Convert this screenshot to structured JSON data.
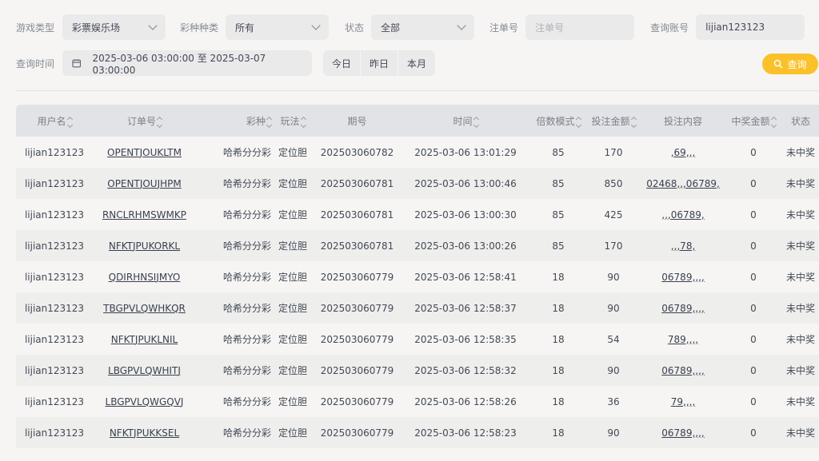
{
  "filters": {
    "game_type_label": "游戏类型",
    "game_type_value": "彩票娱乐场",
    "lottery_label": "彩种种类",
    "lottery_value": "所有",
    "status_label": "状态",
    "status_value": "全部",
    "order_no_label": "注单号",
    "order_no_placeholder": "注单号",
    "account_label": "查询账号",
    "account_value": "lijian123123",
    "time_label": "查询时间",
    "date_range": "2025-03-06 03:00:00 至 2025-03-07 03:00:00",
    "quick_today": "今日",
    "quick_yesterday": "昨日",
    "quick_month": "本月",
    "query_button": "查询"
  },
  "table": {
    "headers": [
      "用户名",
      "订单号",
      "彩种",
      "玩法",
      "期号",
      "时间",
      "倍数模式",
      "投注金额",
      "投注内容",
      "中奖金额",
      "状态"
    ],
    "rows": [
      [
        "lijian123123",
        "OPENTJOUKLTM",
        "哈希分分彩",
        "定位胆",
        "202503060782",
        "2025-03-06 13:01:29",
        "85",
        "170",
        ",69,,,",
        "0",
        "未中奖"
      ],
      [
        "lijian123123",
        "OPENTJOUJHPM",
        "哈希分分彩",
        "定位胆",
        "202503060781",
        "2025-03-06 13:00:46",
        "85",
        "850",
        "02468,,,06789,",
        "0",
        "未中奖"
      ],
      [
        "lijian123123",
        "RNCLRHMSWMKP",
        "哈希分分彩",
        "定位胆",
        "202503060781",
        "2025-03-06 13:00:30",
        "85",
        "425",
        ",,,06789,",
        "0",
        "未中奖"
      ],
      [
        "lijian123123",
        "NFKTJPUKORKL",
        "哈希分分彩",
        "定位胆",
        "202503060781",
        "2025-03-06 13:00:26",
        "85",
        "170",
        ",,,78,",
        "0",
        "未中奖"
      ],
      [
        "lijian123123",
        "QDIRHNSIJMYO",
        "哈希分分彩",
        "定位胆",
        "202503060779",
        "2025-03-06 12:58:41",
        "18",
        "90",
        "06789,,,,",
        "0",
        "未中奖"
      ],
      [
        "lijian123123",
        "TBGPVLQWHKQR",
        "哈希分分彩",
        "定位胆",
        "202503060779",
        "2025-03-06 12:58:37",
        "18",
        "90",
        "06789,,,,",
        "0",
        "未中奖"
      ],
      [
        "lijian123123",
        "NFKTJPUKLNIL",
        "哈希分分彩",
        "定位胆",
        "202503060779",
        "2025-03-06 12:58:35",
        "18",
        "54",
        "789,,,,",
        "0",
        "未中奖"
      ],
      [
        "lijian123123",
        "LBGPVLQWHITJ",
        "哈希分分彩",
        "定位胆",
        "202503060779",
        "2025-03-06 12:58:32",
        "18",
        "90",
        "06789,,,,",
        "0",
        "未中奖"
      ],
      [
        "lijian123123",
        "LBGPVLQWGQVJ",
        "哈希分分彩",
        "定位胆",
        "202503060779",
        "2025-03-06 12:58:26",
        "18",
        "36",
        "79,,,,",
        "0",
        "未中奖"
      ],
      [
        "lijian123123",
        "NFKTJPUKKSEL",
        "哈希分分彩",
        "定位胆",
        "202503060779",
        "2025-03-06 12:58:23",
        "18",
        "90",
        "06789,,,,",
        "0",
        "未中奖"
      ]
    ]
  },
  "colors": {
    "accent": "#fbc12a",
    "header_bg": "#e2e3e7",
    "page_bg": "#f6f5f3",
    "stripe_bg": "#eeeeec"
  }
}
